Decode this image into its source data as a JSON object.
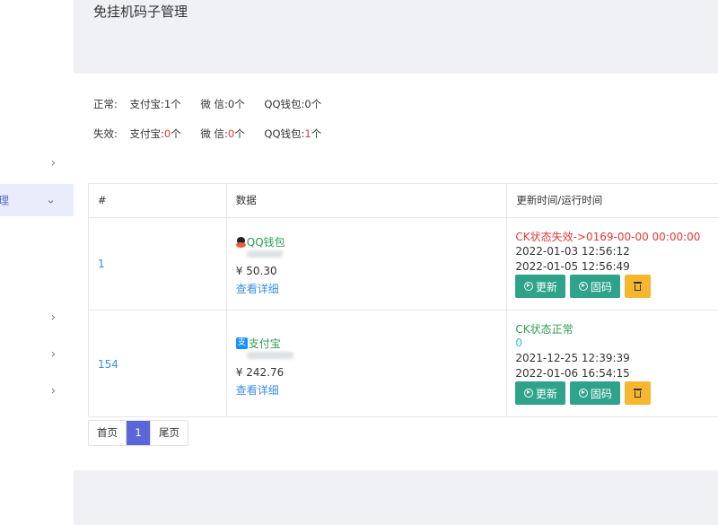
{
  "header": {
    "title": "免挂机码子管理"
  },
  "sidebar": {
    "chevrons": [
      "›",
      "›",
      "›",
      "›",
      "›"
    ],
    "active_fragment": "理",
    "active_chevron": "⌄"
  },
  "summary": {
    "normal": {
      "label": "正常:",
      "alipay_label": "支付宝:",
      "alipay_count": "1",
      "alipay_unit": "个",
      "wechat_label": "微 信:",
      "wechat_count": "0",
      "wechat_unit": "个",
      "qq_label": "QQ钱包:",
      "qq_count": "0",
      "qq_unit": "个"
    },
    "invalid": {
      "label": "失效:",
      "alipay_label": "支付宝:",
      "alipay_count": "0",
      "alipay_unit": "个",
      "wechat_label": "微 信:",
      "wechat_count": "0",
      "wechat_unit": "个",
      "qq_label": "QQ钱包:",
      "qq_count": "1",
      "qq_unit": "个"
    }
  },
  "table": {
    "headers": [
      "#",
      "数据",
      "更新时间/运行时间"
    ],
    "rows": [
      {
        "id": "1",
        "pay_type": "QQ钱包",
        "pay_icon": "qq-penguin-icon",
        "amount": "¥ 50.30",
        "detail": "查看详细",
        "status": "CK状态失效->0169-00-00 00:00:00",
        "status_color": "#e53935",
        "time1": "2022-01-03 12:56:12",
        "time2": "2022-01-05 12:56:49",
        "btn_update": "更新",
        "btn_fix": "固码"
      },
      {
        "id": "154",
        "pay_type": "支付宝",
        "pay_icon": "alipay-icon",
        "pay_icon_glyph": "支",
        "amount": "¥ 242.76",
        "detail": "查看详细",
        "status": "CK状态正常",
        "status_color": "#2e9e4f",
        "status_sub": "0",
        "time1": "2021-12-25 12:39:39",
        "time2": "2022-01-06 16:54:15",
        "btn_update": "更新",
        "btn_fix": "固码"
      }
    ]
  },
  "pagination": {
    "first": "首页",
    "current": "1",
    "last": "尾页"
  },
  "colors": {
    "accent": "#5b67d8",
    "action_green": "#2fa38a",
    "delete_yellow": "#f6b72f",
    "link": "#3a8ee6"
  }
}
